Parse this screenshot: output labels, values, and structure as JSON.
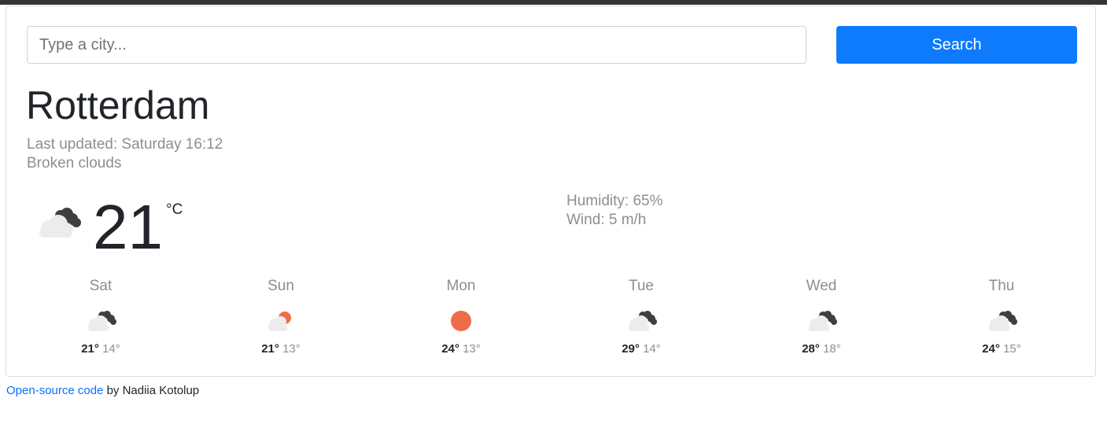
{
  "search": {
    "placeholder": "Type a city...",
    "button_label": "Search"
  },
  "current": {
    "city": "Rotterdam",
    "last_updated": "Last updated: Saturday 16:12",
    "description": "Broken clouds",
    "temperature": "21",
    "unit": "°C",
    "humidity": "Humidity: 65%",
    "wind": "Wind: 5 m/h",
    "icon": "broken-clouds-icon"
  },
  "forecast": [
    {
      "day": "Sat",
      "max": "21°",
      "min": "14°",
      "icon": "broken-clouds-icon"
    },
    {
      "day": "Sun",
      "max": "21°",
      "min": "13°",
      "icon": "partly-cloudy-icon"
    },
    {
      "day": "Mon",
      "max": "24°",
      "min": "13°",
      "icon": "sun-icon"
    },
    {
      "day": "Tue",
      "max": "29°",
      "min": "14°",
      "icon": "broken-clouds-icon"
    },
    {
      "day": "Wed",
      "max": "28°",
      "min": "18°",
      "icon": "broken-clouds-icon"
    },
    {
      "day": "Thu",
      "max": "24°",
      "min": "15°",
      "icon": "broken-clouds-icon"
    }
  ],
  "footer": {
    "link_text": "Open-source code",
    "suffix": " by Nadiia Kotolup"
  },
  "colors": {
    "accent": "#0d7bfc",
    "sun": "#ef6c4b",
    "cloud": "#ececec",
    "dark_cloud": "#3f3f3f"
  }
}
